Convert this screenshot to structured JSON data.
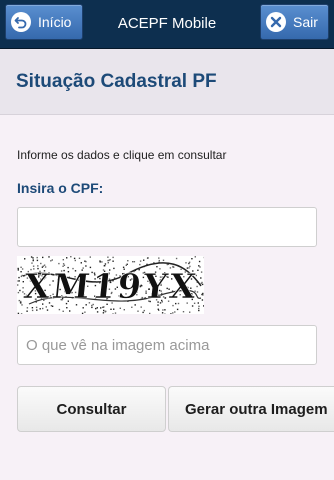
{
  "header": {
    "app_title": "ACEPF Mobile",
    "back_label": "Início",
    "exit_label": "Sair"
  },
  "page": {
    "title": "Situação Cadastral PF"
  },
  "form": {
    "instruction": "Informe os dados e clique em consultar",
    "cpf_label": "Insira o CPF:",
    "cpf_value": "",
    "captcha_text": "XM19YX",
    "captcha_placeholder": "O que vê na imagem acima",
    "captcha_value": "",
    "consultar_label": "Consultar",
    "gerar_label": "Gerar outra Imagem"
  },
  "colors": {
    "topbar": "#0d2f4f",
    "nav_button": "#3f78bd",
    "title": "#1d4a78",
    "background": "#f7f1f7"
  },
  "icons": {
    "back": "back-arrow-circle-icon",
    "exit": "close-x-circle-icon"
  }
}
